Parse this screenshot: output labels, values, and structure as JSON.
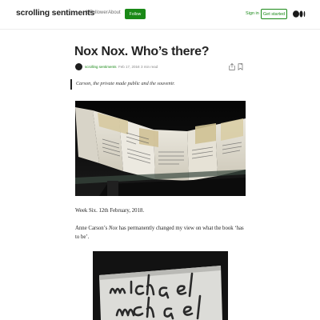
{
  "header": {
    "publication": "scrolling sentiments",
    "followers": "1 Follower",
    "about": "About",
    "follow": "Follow",
    "sign_in": "Sign in",
    "get_started": "Get started",
    "brand_color": "#1a8917"
  },
  "article": {
    "title": "Nox Nox. Who’s there?",
    "author": "scrolling sentiments",
    "date": "Feb 17, 2018",
    "separator": "·",
    "read_time": "3 min read",
    "quote": "Carson, the private made public and the souvenir.",
    "paragraph1": "Week Six. 12th February, 2018.",
    "paragraph2_before": "Anne Carson’s ",
    "paragraph2_italic": "Nox",
    "paragraph2_after": " has permanently changed my view on what the book ‘has to be’."
  },
  "icons": {
    "logo": "medium-logo-icon",
    "share": "share-icon",
    "bookmark": "bookmark-icon"
  }
}
